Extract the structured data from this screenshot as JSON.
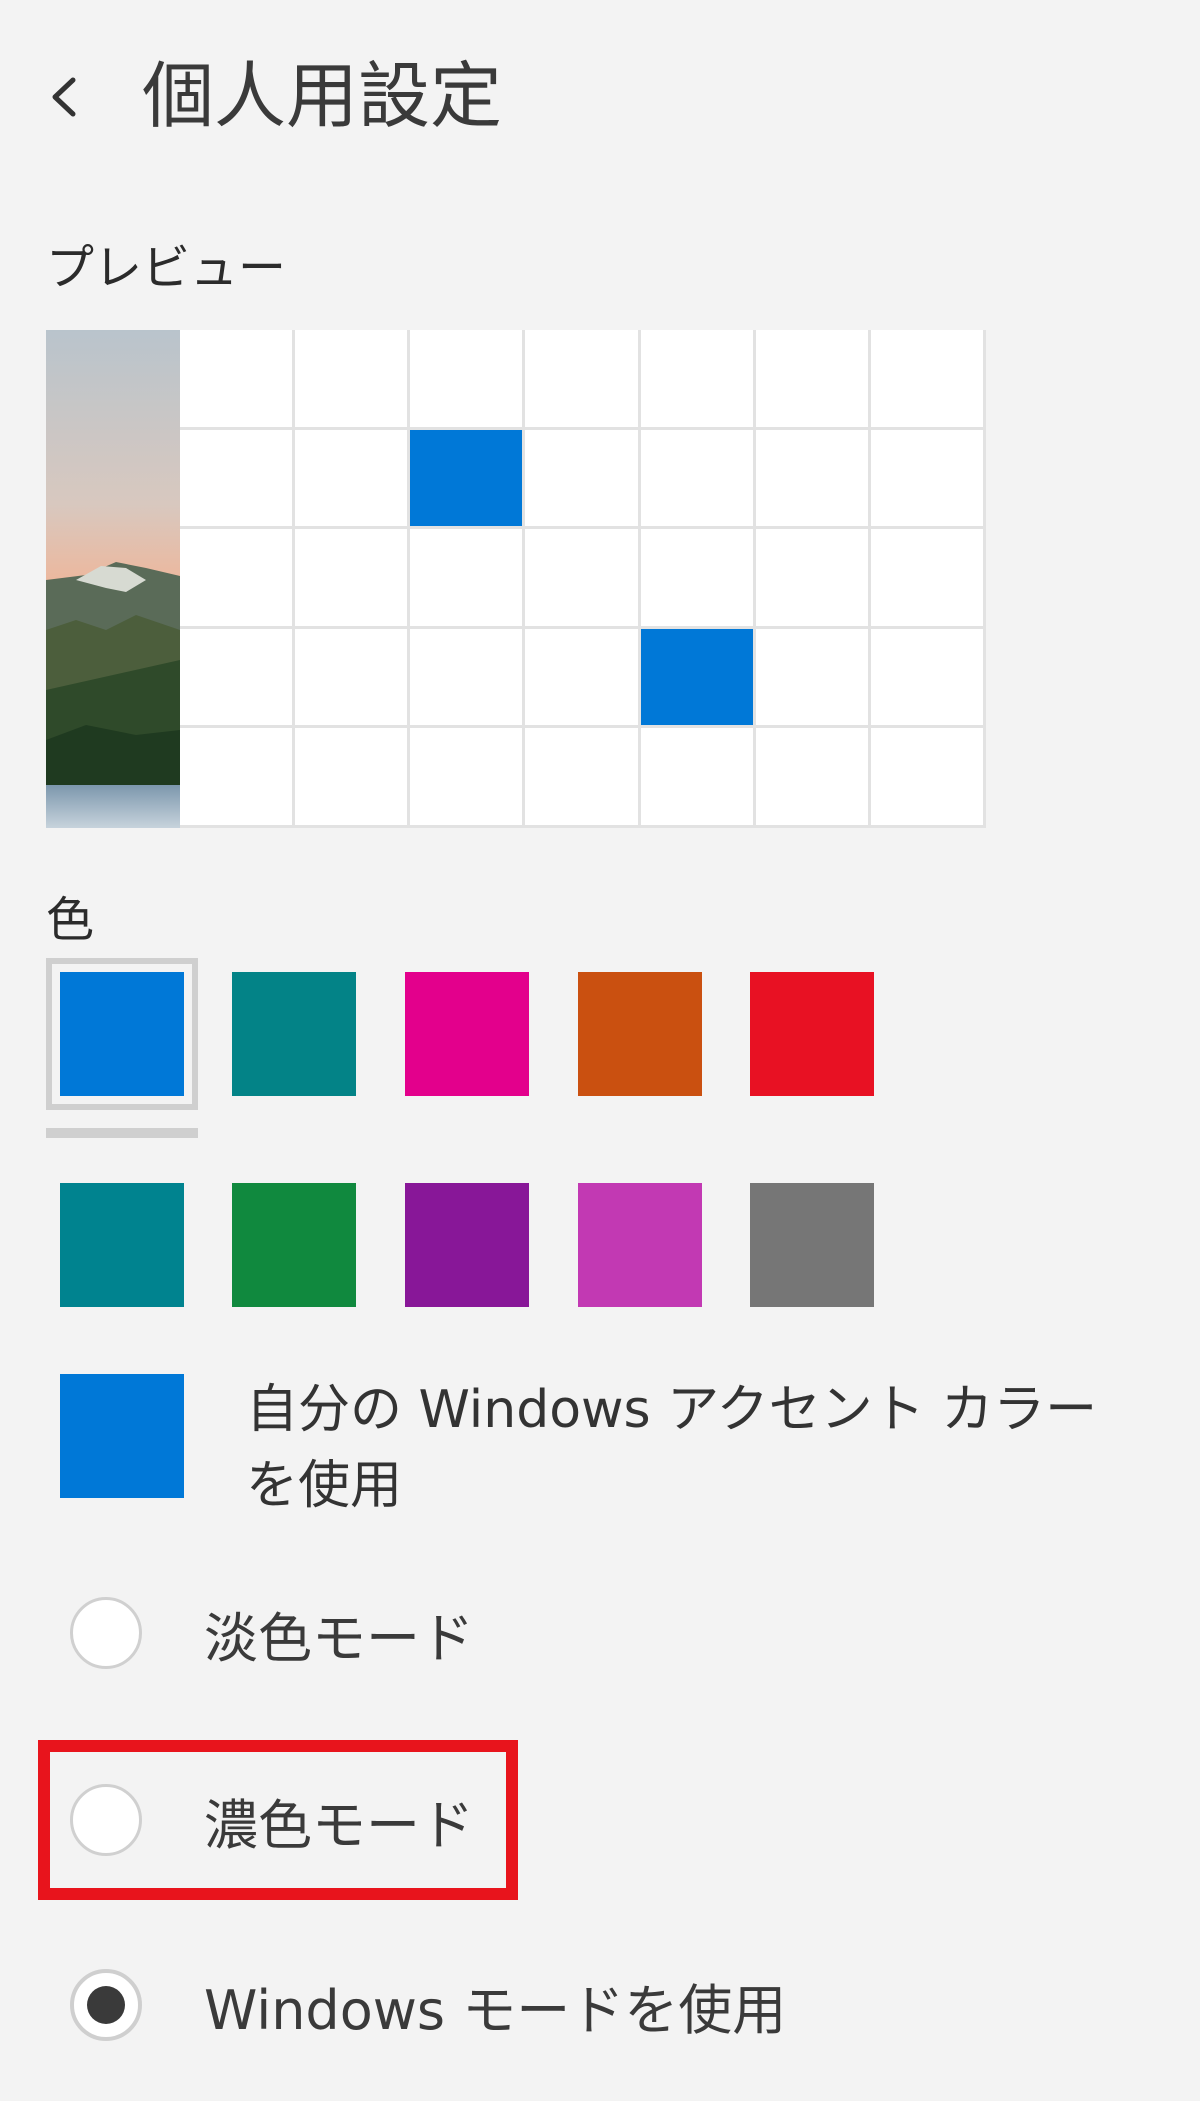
{
  "header": {
    "back_label": "<",
    "title": "個人用設定"
  },
  "preview": {
    "label": "プレビュー",
    "accent_color": "#0078d7",
    "cols": 7,
    "rows": 5,
    "accent_cells": [
      [
        1,
        2
      ],
      [
        3,
        4
      ]
    ]
  },
  "colors": {
    "label": "色",
    "selected_index": 0,
    "swatches": [
      {
        "name": "blue",
        "hex": "#0078d7"
      },
      {
        "name": "teal",
        "hex": "#038387"
      },
      {
        "name": "pink",
        "hex": "#e3008c"
      },
      {
        "name": "orange",
        "hex": "#ca5010"
      },
      {
        "name": "red",
        "hex": "#e81123"
      },
      {
        "name": "petrol",
        "hex": "#00838f"
      },
      {
        "name": "green",
        "hex": "#10893e"
      },
      {
        "name": "purple",
        "hex": "#881798"
      },
      {
        "name": "orchid",
        "hex": "#c239b3"
      },
      {
        "name": "gray",
        "hex": "#767676"
      }
    ],
    "account_swatch_hex": "#0078d7",
    "account_label": "自分の Windows アクセント カラーを使用"
  },
  "modes": {
    "options": [
      {
        "label": "淡色モード",
        "checked": false
      },
      {
        "label": "濃色モード",
        "checked": false
      },
      {
        "label": "Windows モードを使用",
        "checked": true
      }
    ],
    "highlighted_option": 1
  }
}
